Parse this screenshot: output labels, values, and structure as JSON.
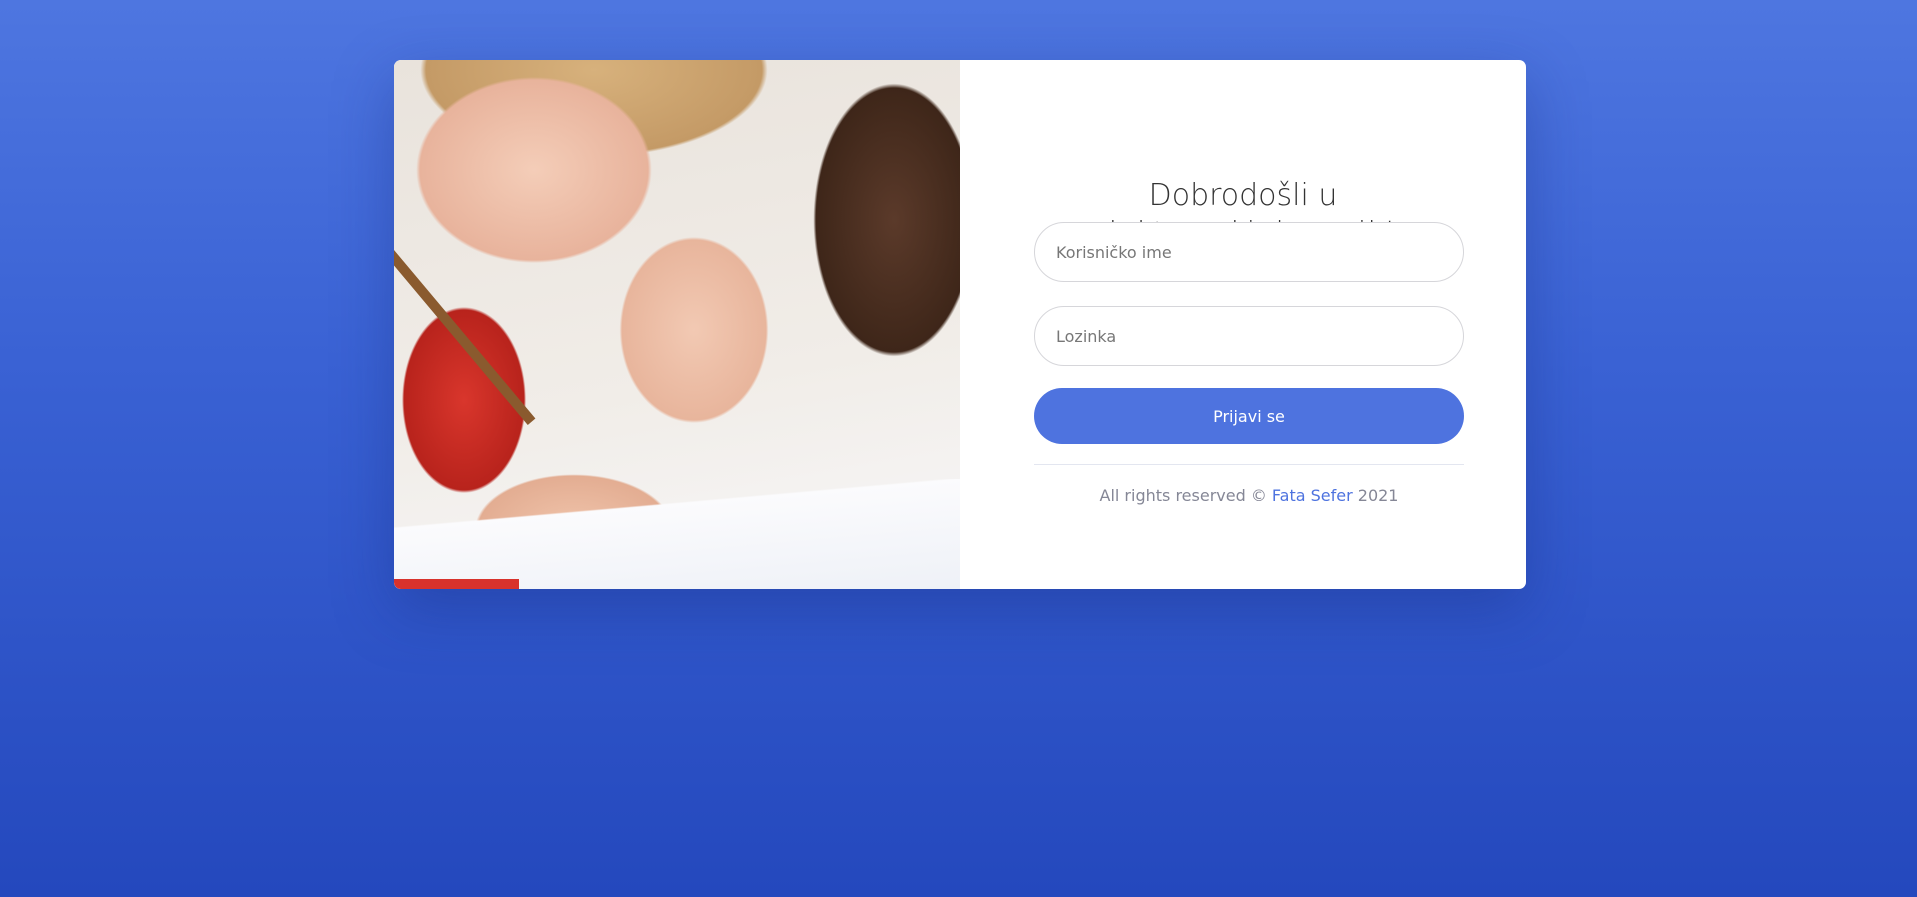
{
  "login": {
    "title": "Dobrodošli u elektronski dnevnik!",
    "username_placeholder": "Korisničko ime",
    "password_placeholder": "Lozinka",
    "submit_label": "Prijavi se",
    "footer": {
      "prefix": "All rights reserved © ",
      "author_link": "Fata Sefer",
      "suffix": " 2021"
    }
  },
  "image": {
    "description_icon": "photo-children-drawing"
  },
  "colors": {
    "accent": "#4e73df",
    "background_top": "#4e76e0",
    "background_bottom": "#2448bd"
  }
}
